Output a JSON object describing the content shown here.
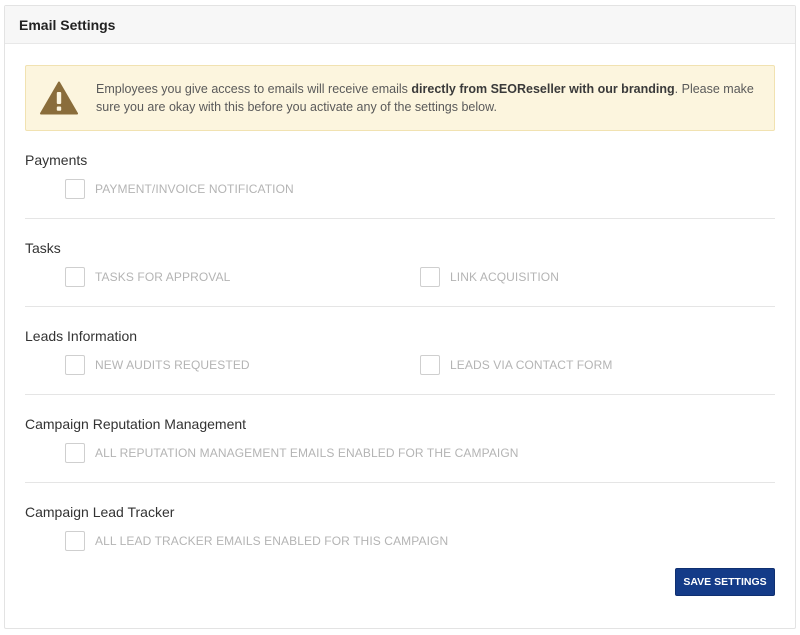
{
  "header": {
    "title": "Email Settings"
  },
  "alert": {
    "icon": "warning-triangle-icon",
    "text_before": "Employees you give access to emails will receive emails ",
    "text_bold": "directly from SEOReseller with our branding",
    "text_after": ". Please make sure you are okay with this before you activate any of the settings below."
  },
  "sections": [
    {
      "title": "Payments",
      "options": [
        {
          "label": "PAYMENT/INVOICE NOTIFICATION",
          "checked": false
        }
      ]
    },
    {
      "title": "Tasks",
      "options": [
        {
          "label": "TASKS FOR APPROVAL",
          "checked": false
        },
        {
          "label": "LINK ACQUISITION",
          "checked": false
        }
      ]
    },
    {
      "title": "Leads Information",
      "options": [
        {
          "label": "NEW AUDITS REQUESTED",
          "checked": false
        },
        {
          "label": "LEADS VIA CONTACT FORM",
          "checked": false
        }
      ]
    },
    {
      "title": "Campaign Reputation Management",
      "options": [
        {
          "label": "ALL REPUTATION MANAGEMENT EMAILS ENABLED FOR THE CAMPAIGN",
          "checked": false
        }
      ]
    },
    {
      "title": "Campaign Lead Tracker",
      "options": [
        {
          "label": "ALL LEAD TRACKER EMAILS ENABLED FOR THIS CAMPAIGN",
          "checked": false
        }
      ]
    }
  ],
  "footer": {
    "save_label": "SAVE SETTINGS"
  },
  "colors": {
    "accent": "#143b88",
    "alert_bg": "#fcf5de",
    "alert_icon": "#8a6d3b"
  }
}
